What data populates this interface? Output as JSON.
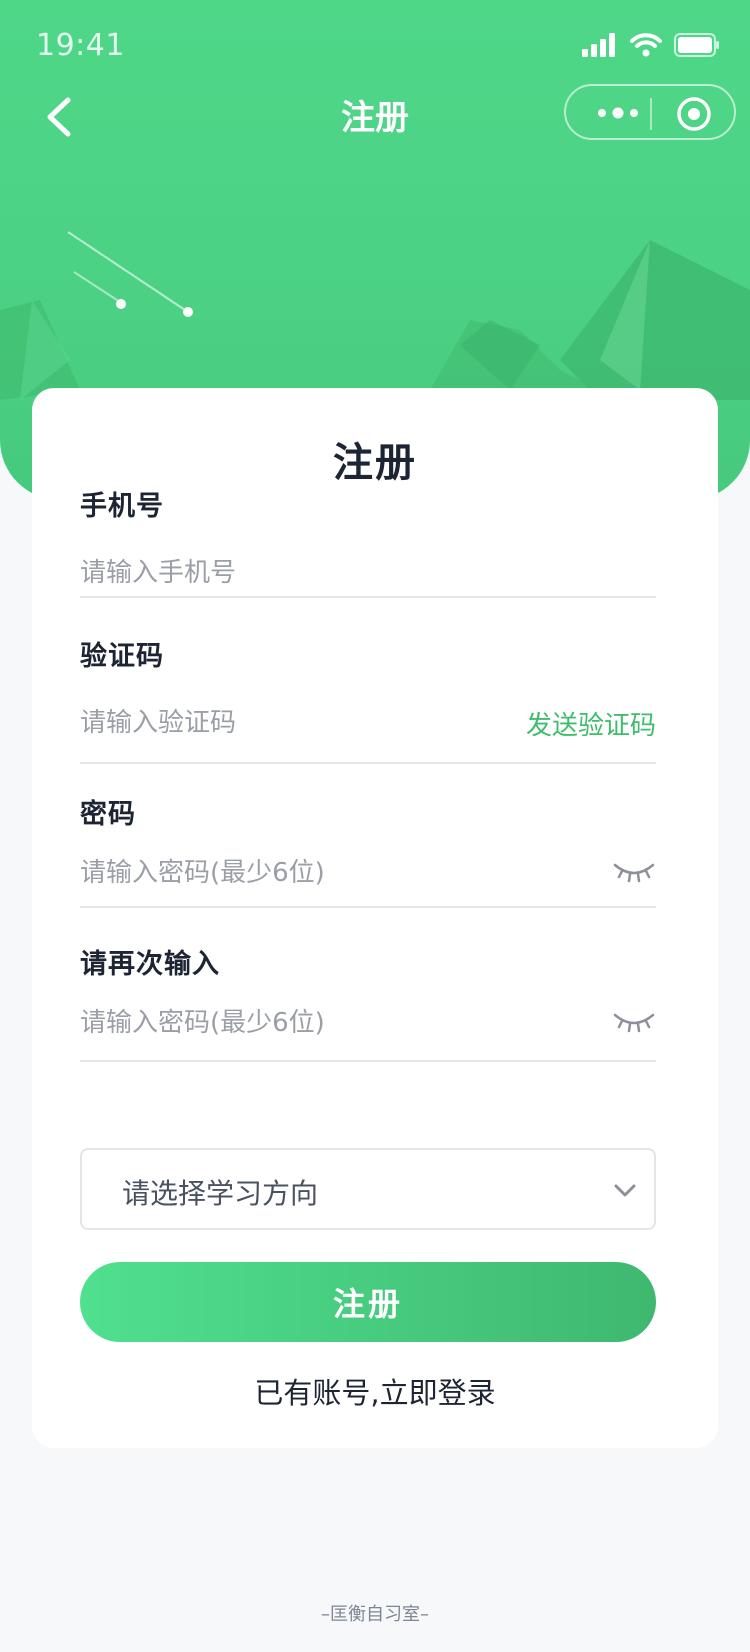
{
  "status_bar": {
    "time": "19:41"
  },
  "nav": {
    "title": "注册"
  },
  "card": {
    "title": "注册",
    "fields": [
      {
        "label": "手机号",
        "placeholder": "请输入手机号"
      },
      {
        "label": "验证码",
        "placeholder": "请输入验证码",
        "action": "发送验证码"
      },
      {
        "label": "密码",
        "placeholder": "请输入密码(最少6位)"
      },
      {
        "label": "请再次输入",
        "placeholder": "请输入密码(最少6位)"
      }
    ],
    "select": {
      "placeholder": "请选择学习方向"
    },
    "submit_label": "注册",
    "login_link": "已有账号,立即登录"
  },
  "footer": "–匡衡自习室–",
  "colors": {
    "primary": "#4cd184",
    "accent_text": "#3fbd6d",
    "text_dark": "#1d2433",
    "placeholder": "#9a9ea6"
  },
  "icons": [
    "back-icon",
    "more-icon",
    "target-icon",
    "eye-closed-icon",
    "chevron-down-icon",
    "signal-icon",
    "wifi-icon",
    "battery-icon"
  ]
}
